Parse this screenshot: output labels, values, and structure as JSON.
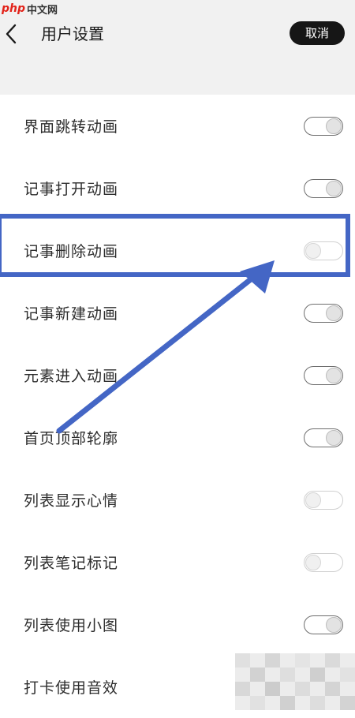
{
  "watermark": {
    "logo": "php",
    "site": "中文网"
  },
  "header": {
    "back_icon": "chevron-left-icon",
    "title": "用户设置",
    "cancel_label": "取消"
  },
  "settings": [
    {
      "label": "界面跳转动画",
      "enabled": true
    },
    {
      "label": "记事打开动画",
      "enabled": true
    },
    {
      "label": "记事删除动画",
      "enabled": false
    },
    {
      "label": "记事新建动画",
      "enabled": true
    },
    {
      "label": "元素进入动画",
      "enabled": true
    },
    {
      "label": "首页顶部轮廓",
      "enabled": true
    },
    {
      "label": "列表显示心情",
      "enabled": false
    },
    {
      "label": "列表笔记标记",
      "enabled": false
    },
    {
      "label": "列表使用小图",
      "enabled": true
    },
    {
      "label": "打卡使用音效",
      "enabled": true
    }
  ],
  "annotation": {
    "color": "#4466c5",
    "highlighted_item": "记事删除动画"
  },
  "colors": {
    "background": "#ffffff",
    "header_bg": "#f1f1f1",
    "button_bg": "#161616"
  }
}
